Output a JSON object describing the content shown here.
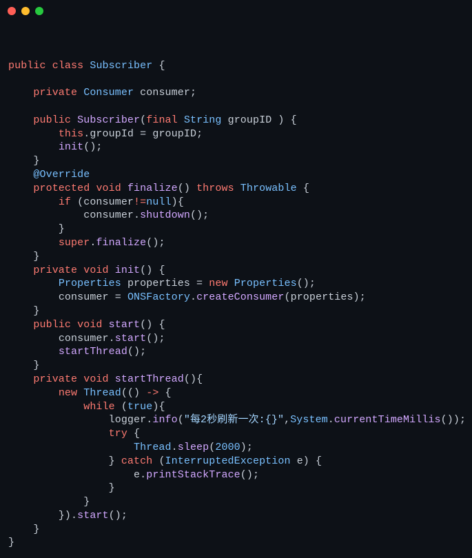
{
  "window": {
    "dots": [
      "red",
      "yellow",
      "green"
    ]
  },
  "code": {
    "tokens": [
      [
        {
          "t": "\n",
          "c": ""
        }
      ],
      [
        {
          "t": "public",
          "c": "kw"
        },
        {
          "t": " ",
          "c": ""
        },
        {
          "t": "class",
          "c": "kw"
        },
        {
          "t": " ",
          "c": ""
        },
        {
          "t": "Subscriber",
          "c": "type"
        },
        {
          "t": " {",
          "c": ""
        }
      ],
      [
        {
          "t": "",
          "c": ""
        }
      ],
      [
        {
          "t": "    ",
          "c": ""
        },
        {
          "t": "private",
          "c": "kw"
        },
        {
          "t": " ",
          "c": ""
        },
        {
          "t": "Consumer",
          "c": "type"
        },
        {
          "t": " ",
          "c": ""
        },
        {
          "t": "consumer",
          "c": "var"
        },
        {
          "t": ";",
          "c": ""
        }
      ],
      [
        {
          "t": "",
          "c": ""
        }
      ],
      [
        {
          "t": "    ",
          "c": ""
        },
        {
          "t": "public",
          "c": "kw"
        },
        {
          "t": " ",
          "c": ""
        },
        {
          "t": "Subscriber",
          "c": "method"
        },
        {
          "t": "(",
          "c": ""
        },
        {
          "t": "final",
          "c": "kw"
        },
        {
          "t": " ",
          "c": ""
        },
        {
          "t": "String",
          "c": "type"
        },
        {
          "t": " ",
          "c": ""
        },
        {
          "t": "groupID",
          "c": "var"
        },
        {
          "t": " ) {",
          "c": ""
        }
      ],
      [
        {
          "t": "        ",
          "c": ""
        },
        {
          "t": "this",
          "c": "kw"
        },
        {
          "t": ".",
          "c": ""
        },
        {
          "t": "groupId",
          "c": "field"
        },
        {
          "t": " = ",
          "c": ""
        },
        {
          "t": "groupID",
          "c": "var"
        },
        {
          "t": ";",
          "c": ""
        }
      ],
      [
        {
          "t": "        ",
          "c": ""
        },
        {
          "t": "init",
          "c": "method"
        },
        {
          "t": "();",
          "c": ""
        }
      ],
      [
        {
          "t": "    }",
          "c": ""
        }
      ],
      [
        {
          "t": "    ",
          "c": ""
        },
        {
          "t": "@Override",
          "c": "anno"
        }
      ],
      [
        {
          "t": "    ",
          "c": ""
        },
        {
          "t": "protected",
          "c": "kw"
        },
        {
          "t": " ",
          "c": ""
        },
        {
          "t": "void",
          "c": "kw"
        },
        {
          "t": " ",
          "c": ""
        },
        {
          "t": "finalize",
          "c": "method"
        },
        {
          "t": "() ",
          "c": ""
        },
        {
          "t": "throws",
          "c": "kw"
        },
        {
          "t": " ",
          "c": ""
        },
        {
          "t": "Throwable",
          "c": "type"
        },
        {
          "t": " {",
          "c": ""
        }
      ],
      [
        {
          "t": "        ",
          "c": ""
        },
        {
          "t": "if",
          "c": "kw"
        },
        {
          "t": " (",
          "c": ""
        },
        {
          "t": "consumer",
          "c": "var"
        },
        {
          "t": "!=",
          "c": "kw"
        },
        {
          "t": "null",
          "c": "const"
        },
        {
          "t": "){",
          "c": ""
        }
      ],
      [
        {
          "t": "            ",
          "c": ""
        },
        {
          "t": "consumer",
          "c": "var"
        },
        {
          "t": ".",
          "c": ""
        },
        {
          "t": "shutdown",
          "c": "method"
        },
        {
          "t": "();",
          "c": ""
        }
      ],
      [
        {
          "t": "        }",
          "c": ""
        }
      ],
      [
        {
          "t": "        ",
          "c": ""
        },
        {
          "t": "super",
          "c": "kw"
        },
        {
          "t": ".",
          "c": ""
        },
        {
          "t": "finalize",
          "c": "method"
        },
        {
          "t": "();",
          "c": ""
        }
      ],
      [
        {
          "t": "    }",
          "c": ""
        }
      ],
      [
        {
          "t": "    ",
          "c": ""
        },
        {
          "t": "private",
          "c": "kw"
        },
        {
          "t": " ",
          "c": ""
        },
        {
          "t": "void",
          "c": "kw"
        },
        {
          "t": " ",
          "c": ""
        },
        {
          "t": "init",
          "c": "method"
        },
        {
          "t": "() {",
          "c": ""
        }
      ],
      [
        {
          "t": "        ",
          "c": ""
        },
        {
          "t": "Properties",
          "c": "type"
        },
        {
          "t": " ",
          "c": ""
        },
        {
          "t": "properties",
          "c": "var"
        },
        {
          "t": " = ",
          "c": ""
        },
        {
          "t": "new",
          "c": "kw"
        },
        {
          "t": " ",
          "c": ""
        },
        {
          "t": "Properties",
          "c": "type"
        },
        {
          "t": "();",
          "c": ""
        }
      ],
      [
        {
          "t": "        ",
          "c": ""
        },
        {
          "t": "consumer",
          "c": "var"
        },
        {
          "t": " = ",
          "c": ""
        },
        {
          "t": "ONSFactory",
          "c": "type"
        },
        {
          "t": ".",
          "c": ""
        },
        {
          "t": "createConsumer",
          "c": "method"
        },
        {
          "t": "(",
          "c": ""
        },
        {
          "t": "properties",
          "c": "var"
        },
        {
          "t": ");",
          "c": ""
        }
      ],
      [
        {
          "t": "    }",
          "c": ""
        }
      ],
      [
        {
          "t": "    ",
          "c": ""
        },
        {
          "t": "public",
          "c": "kw"
        },
        {
          "t": " ",
          "c": ""
        },
        {
          "t": "void",
          "c": "kw"
        },
        {
          "t": " ",
          "c": ""
        },
        {
          "t": "start",
          "c": "method"
        },
        {
          "t": "() {",
          "c": ""
        }
      ],
      [
        {
          "t": "        ",
          "c": ""
        },
        {
          "t": "consumer",
          "c": "var"
        },
        {
          "t": ".",
          "c": ""
        },
        {
          "t": "start",
          "c": "method"
        },
        {
          "t": "();",
          "c": ""
        }
      ],
      [
        {
          "t": "        ",
          "c": ""
        },
        {
          "t": "startThread",
          "c": "method"
        },
        {
          "t": "();",
          "c": ""
        }
      ],
      [
        {
          "t": "    }",
          "c": ""
        }
      ],
      [
        {
          "t": "    ",
          "c": ""
        },
        {
          "t": "private",
          "c": "kw"
        },
        {
          "t": " ",
          "c": ""
        },
        {
          "t": "void",
          "c": "kw"
        },
        {
          "t": " ",
          "c": ""
        },
        {
          "t": "startThread",
          "c": "method"
        },
        {
          "t": "(){",
          "c": ""
        }
      ],
      [
        {
          "t": "        ",
          "c": ""
        },
        {
          "t": "new",
          "c": "kw"
        },
        {
          "t": " ",
          "c": ""
        },
        {
          "t": "Thread",
          "c": "type"
        },
        {
          "t": "(() ",
          "c": ""
        },
        {
          "t": "->",
          "c": "arrow"
        },
        {
          "t": " {",
          "c": ""
        }
      ],
      [
        {
          "t": "            ",
          "c": ""
        },
        {
          "t": "while",
          "c": "kw"
        },
        {
          "t": " (",
          "c": ""
        },
        {
          "t": "true",
          "c": "const"
        },
        {
          "t": "){",
          "c": ""
        }
      ],
      [
        {
          "t": "                ",
          "c": ""
        },
        {
          "t": "logger",
          "c": "var"
        },
        {
          "t": ".",
          "c": ""
        },
        {
          "t": "info",
          "c": "method"
        },
        {
          "t": "(",
          "c": ""
        },
        {
          "t": "\"每2秒刷新一次:{}\"",
          "c": "str"
        },
        {
          "t": ",",
          "c": ""
        },
        {
          "t": "System",
          "c": "type"
        },
        {
          "t": ".",
          "c": ""
        },
        {
          "t": "currentTimeMillis",
          "c": "method"
        },
        {
          "t": "());",
          "c": ""
        }
      ],
      [
        {
          "t": "                ",
          "c": ""
        },
        {
          "t": "try",
          "c": "kw"
        },
        {
          "t": " {",
          "c": ""
        }
      ],
      [
        {
          "t": "                    ",
          "c": ""
        },
        {
          "t": "Thread",
          "c": "type"
        },
        {
          "t": ".",
          "c": ""
        },
        {
          "t": "sleep",
          "c": "method"
        },
        {
          "t": "(",
          "c": ""
        },
        {
          "t": "2000",
          "c": "num"
        },
        {
          "t": ");",
          "c": ""
        }
      ],
      [
        {
          "t": "                } ",
          "c": ""
        },
        {
          "t": "catch",
          "c": "kw"
        },
        {
          "t": " (",
          "c": ""
        },
        {
          "t": "InterruptedException",
          "c": "type"
        },
        {
          "t": " ",
          "c": ""
        },
        {
          "t": "e",
          "c": "var"
        },
        {
          "t": ") {",
          "c": ""
        }
      ],
      [
        {
          "t": "                    ",
          "c": ""
        },
        {
          "t": "e",
          "c": "var"
        },
        {
          "t": ".",
          "c": ""
        },
        {
          "t": "printStackTrace",
          "c": "method"
        },
        {
          "t": "();",
          "c": ""
        }
      ],
      [
        {
          "t": "                }",
          "c": ""
        }
      ],
      [
        {
          "t": "            }",
          "c": ""
        }
      ],
      [
        {
          "t": "        }).",
          "c": ""
        },
        {
          "t": "start",
          "c": "method"
        },
        {
          "t": "();",
          "c": ""
        }
      ],
      [
        {
          "t": "    }",
          "c": ""
        }
      ],
      [
        {
          "t": "}",
          "c": ""
        }
      ]
    ]
  }
}
